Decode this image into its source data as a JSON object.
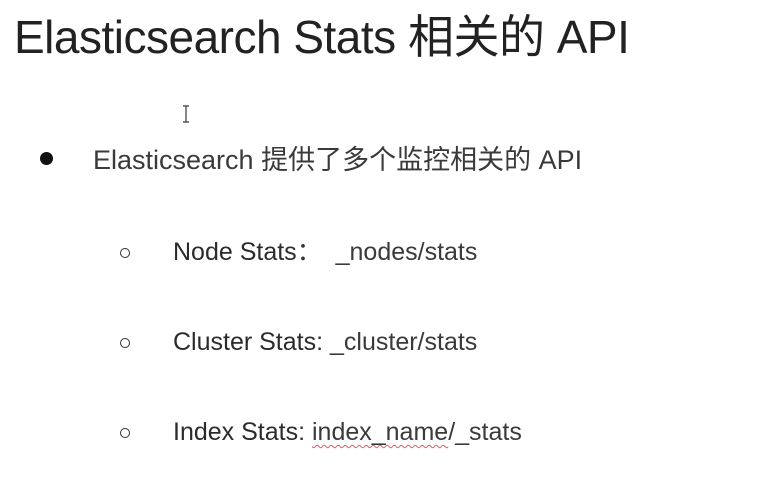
{
  "slide": {
    "title": "Elasticsearch Stats 相关的 API",
    "bullet": "Elasticsearch 提供了多个监控相关的 API",
    "items": [
      {
        "label": "Node Stats",
        "separator": "：",
        "value": "_nodes/stats"
      },
      {
        "label": "Cluster Stats",
        "separator": ": ",
        "value": "_cluster/stats"
      },
      {
        "label": "Index Stats",
        "separator": ": ",
        "value_underlined": "index_name",
        "value_rest": "/_stats"
      }
    ]
  },
  "icons": {
    "cursor": "text-cursor-icon",
    "bullet_level1": "filled-circle-bullet-icon",
    "bullet_level2": "hollow-circle-bullet-icon"
  },
  "colors": {
    "text": "#2b2b2b",
    "spellcheck_underline": "#e05a6a"
  }
}
